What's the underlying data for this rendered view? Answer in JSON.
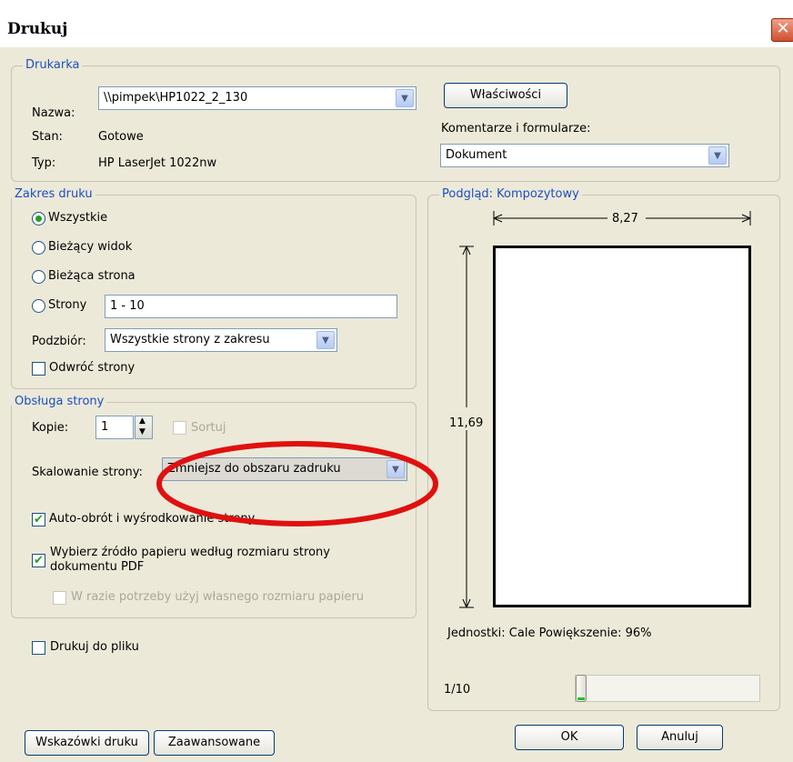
{
  "title": "Drukuj",
  "printer": {
    "group_title": "Drukarka",
    "name_label": "Nazwa:",
    "name_value": "\\\\pimpek\\HP1022_2_130",
    "status_label": "Stan:",
    "status_value": "Gotowe",
    "type_label": "Typ:",
    "type_value": "HP LaserJet 1022nw",
    "properties_button": "Właściwości",
    "comments_label": "Komentarze i formularze:",
    "comments_value": "Dokument"
  },
  "range": {
    "group_title": "Zakres druku",
    "options": [
      "Wszystkie",
      "Bieżący widok",
      "Bieżąca strona",
      "Strony"
    ],
    "selected": "Wszystkie",
    "pages_value": "1 - 10",
    "subset_label": "Podzbiór:",
    "subset_value": "Wszystkie strony z zakresu",
    "reverse_label": "Odwróć strony"
  },
  "handling": {
    "group_title": "Obsługa strony",
    "copies_label": "Kopie:",
    "copies_value": "1",
    "collate_label": "Sortuj",
    "scaling_label": "Skalowanie strony:",
    "scaling_value": "Zmniejsz do obszaru zadruku",
    "autorotate_label": "Auto-obrót i wyśrodkowanie strony",
    "choose_source_label_1": "Wybierz źródło papieru według rozmiaru strony",
    "choose_source_label_2": "dokumentu PDF",
    "custom_paper_label": "W razie potrzeby użyj własnego rozmiaru papieru"
  },
  "print_to_file_label": "Drukuj do pliku",
  "preview": {
    "group_title": "Podgląd: Kompozytowy",
    "width": "8,27",
    "height": "11,69",
    "units_text": "Jednostki: Cale Powiększenie:  96%",
    "page_indicator": "1/10"
  },
  "buttons": {
    "tips": "Wskazówki druku",
    "advanced": "Zaawansowane",
    "ok": "OK",
    "cancel": "Anuluj"
  },
  "colors": {
    "annotation_ring": "#e01010",
    "group_title": "#1c4fc4"
  }
}
